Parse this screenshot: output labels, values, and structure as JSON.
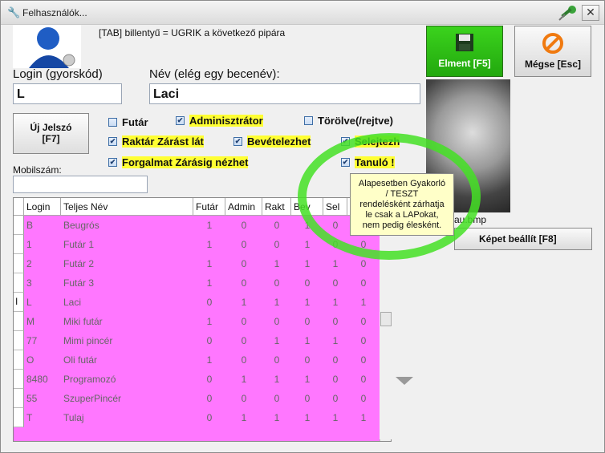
{
  "window": {
    "title": "Felhasználók..."
  },
  "hint_text": "[TAB] billentyű = UGRIK a következő pipára",
  "login": {
    "label": "Login (gyorskód)",
    "value": "L"
  },
  "name": {
    "label": "Név (elég egy becenév)",
    "suffix": ":",
    "value": "Laci"
  },
  "new_password_button": {
    "line1": "Új Jelszó",
    "line2": "[F7]"
  },
  "mobile": {
    "label": "Mobilszám:",
    "value": ""
  },
  "checkboxes": [
    {
      "label": "Futár",
      "checked": false
    },
    {
      "label": "Adminisztrátor",
      "checked": true
    },
    {
      "label": "Törölve(/rejtve)",
      "checked": false
    },
    {
      "label": "Raktár Zárást lát",
      "checked": true
    },
    {
      "label": "Bevételezhet",
      "checked": true
    },
    {
      "label": "Selejtezh",
      "checked": true
    },
    {
      "label": "Forgalmat Zárásig nézhet",
      "checked": true
    },
    {
      "label": "Tanuló !",
      "checked": true
    }
  ],
  "save_button": {
    "label": "Elment [F5]"
  },
  "cancel_button": {
    "label": "Mégse [Esc]"
  },
  "photo_filename": "au.bmp",
  "set_picture_button": {
    "label": "Képet beállít [F8]"
  },
  "tooltip": {
    "lines": [
      "Alapesetben Gyakorló",
      "/ TESZT",
      "rendelésként zárhatja",
      "le csak a LAPokat,",
      "nem pedig élesként."
    ]
  },
  "table": {
    "columns": [
      "Login",
      "Teljes Név",
      "Futár",
      "Admin",
      "Rakt",
      "Bev",
      "Sel"
    ],
    "rows": [
      [
        "B",
        "Beugrós",
        "1",
        "0",
        "0",
        "1",
        "0",
        "0"
      ],
      [
        "1",
        "Futár 1",
        "1",
        "0",
        "0",
        "1",
        "0",
        "0"
      ],
      [
        "2",
        "Futár 2",
        "1",
        "0",
        "1",
        "1",
        "1",
        "0"
      ],
      [
        "3",
        "Futár 3",
        "1",
        "0",
        "0",
        "0",
        "0",
        "0"
      ],
      [
        "L",
        "Laci",
        "0",
        "1",
        "1",
        "1",
        "1",
        "1"
      ],
      [
        "M",
        "Miki futár",
        "1",
        "0",
        "0",
        "0",
        "0",
        "0"
      ],
      [
        "77",
        "Mimi pincér",
        "0",
        "0",
        "1",
        "1",
        "1",
        "0"
      ],
      [
        "O",
        "Oli futár",
        "1",
        "0",
        "0",
        "0",
        "0",
        "0"
      ],
      [
        "8480",
        "Programozó",
        "0",
        "1",
        "1",
        "1",
        "0",
        "0"
      ],
      [
        "55",
        "SzuperPincér",
        "0",
        "0",
        "0",
        "0",
        "0",
        "0"
      ],
      [
        "T",
        "Tulaj",
        "0",
        "1",
        "1",
        "1",
        "1",
        "1"
      ]
    ],
    "current_row_marker": "I"
  },
  "colors": {
    "grid_bg": "#ff77ff",
    "save_green": "#22a80e",
    "highlight": "#ffff33",
    "ring": "#44e024"
  }
}
